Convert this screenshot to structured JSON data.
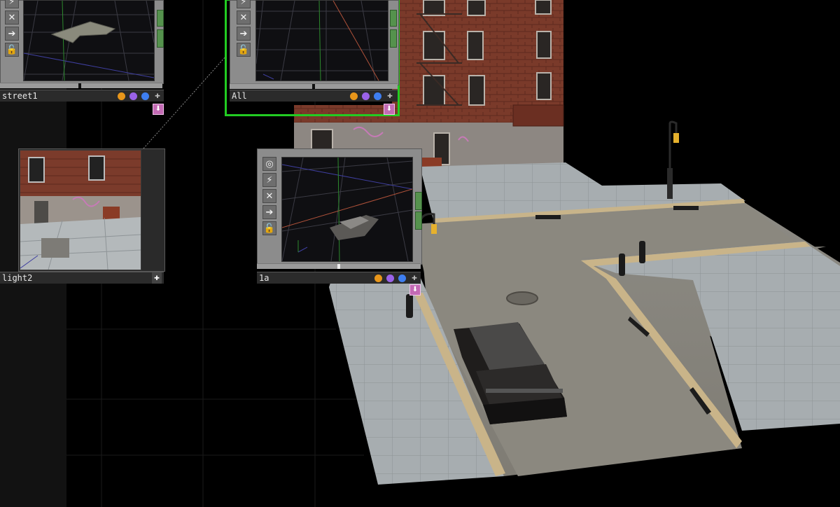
{
  "nodes": {
    "street1": {
      "name": "street1",
      "flags": [
        "#e8961a",
        "#9a62e8",
        "#3e7ef0"
      ]
    },
    "all": {
      "name": "All",
      "flags": [
        "#e8961a",
        "#9a62e8",
        "#3e7ef0"
      ]
    },
    "light2": {
      "name": "light2"
    },
    "node_1a": {
      "name": "1a",
      "flags": [
        "#e8961a",
        "#9a62e8",
        "#3e7ef0"
      ]
    }
  },
  "icons": {
    "radio": "◎",
    "pulse": "⚡",
    "close": "✕",
    "arrow": "➔",
    "lock": "🔓",
    "plus": "✚",
    "down": "⬇"
  },
  "colors": {
    "selection_border": "#22cc22",
    "output_connector": "#c36ab4",
    "node_body": "#8c8c8c",
    "footer": "#2b2b2b",
    "background": "#000000"
  }
}
